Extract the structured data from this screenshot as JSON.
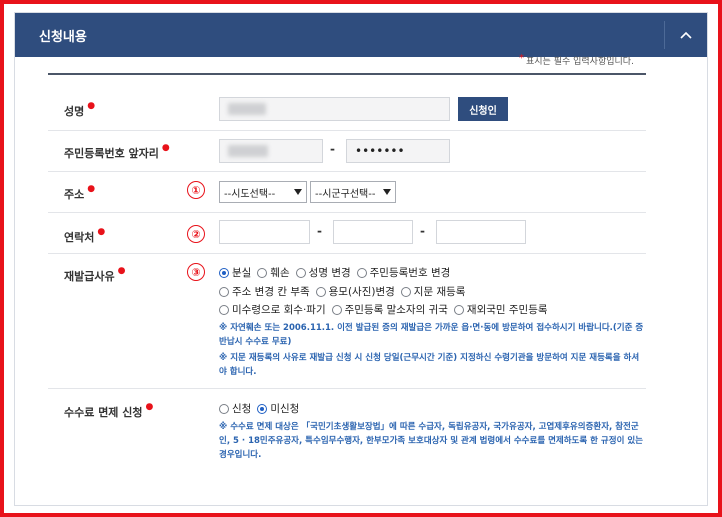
{
  "panel": {
    "title": "신청내용"
  },
  "required_note": "표시는 필수 입력사항입니다.",
  "fields": {
    "name": {
      "label": "성명",
      "applicant_button": "신청인"
    },
    "rrn": {
      "label": "주민등록번호 앞자리",
      "back_value": "•••••••",
      "separator": "-"
    },
    "address": {
      "label": "주소",
      "marker": "①",
      "sido_select": "--시도선택--",
      "sigungu_select": "--시군구선택--"
    },
    "contact": {
      "label": "연락처",
      "marker": "②",
      "separator": "-"
    },
    "reason": {
      "label": "재발급사유",
      "marker": "③",
      "options_row1": [
        "분실",
        "훼손",
        "성명 변경",
        "주민등록번호 변경"
      ],
      "options_row2": [
        "주소 변경 칸 부족",
        "용모(사진)변경",
        "지문 재등록"
      ],
      "options_row3": [
        "미수령으로 회수·파기",
        "주민등록 말소자의 귀국",
        "재외국민 주민등록"
      ],
      "selected": "분실",
      "note1_line1": "※ 자연훼손 또는 2006.11.1. 이전 발급된 증의 재발급은 가까운 읍·면·동에 방문하여 접수하시기 바랍니다.(기준 증",
      "note1_line2": "반납시 수수료 무료)",
      "note2_line1": "※ 지문 재등록의 사유로 재발급 신청 시 신청 당일(근무시간 기준) 지정하신 수령기관을 방문하여 지문 재등록을 하셔",
      "note2_line2": "야 합니다."
    },
    "fee": {
      "label": "수수료 면제 신청",
      "options": [
        "신청",
        "미신청"
      ],
      "selected": "미신청",
      "note_line1": "※ 수수료 면제 대상은 「국민기초생활보장법」에 따른 수급자, 독립유공자, 국가유공자, 고엽제후유의증환자, 참전군",
      "note_line2": "인, 5 · 18민주유공자, 특수임무수행자, 한부모가족 보호대상자 및 관계 법령에서 수수료를 면제하도록 한 규정이 있는",
      "note_line3": "경우입니다."
    }
  },
  "colors": {
    "header": "#2f4d7e",
    "accent_red": "#e8121a",
    "note_blue": "#2b64b0",
    "radio_blue": "#1f5fc4"
  },
  "icons": {
    "toggle": "chevron-up-icon",
    "select_arrow": "chevron-down-icon"
  }
}
